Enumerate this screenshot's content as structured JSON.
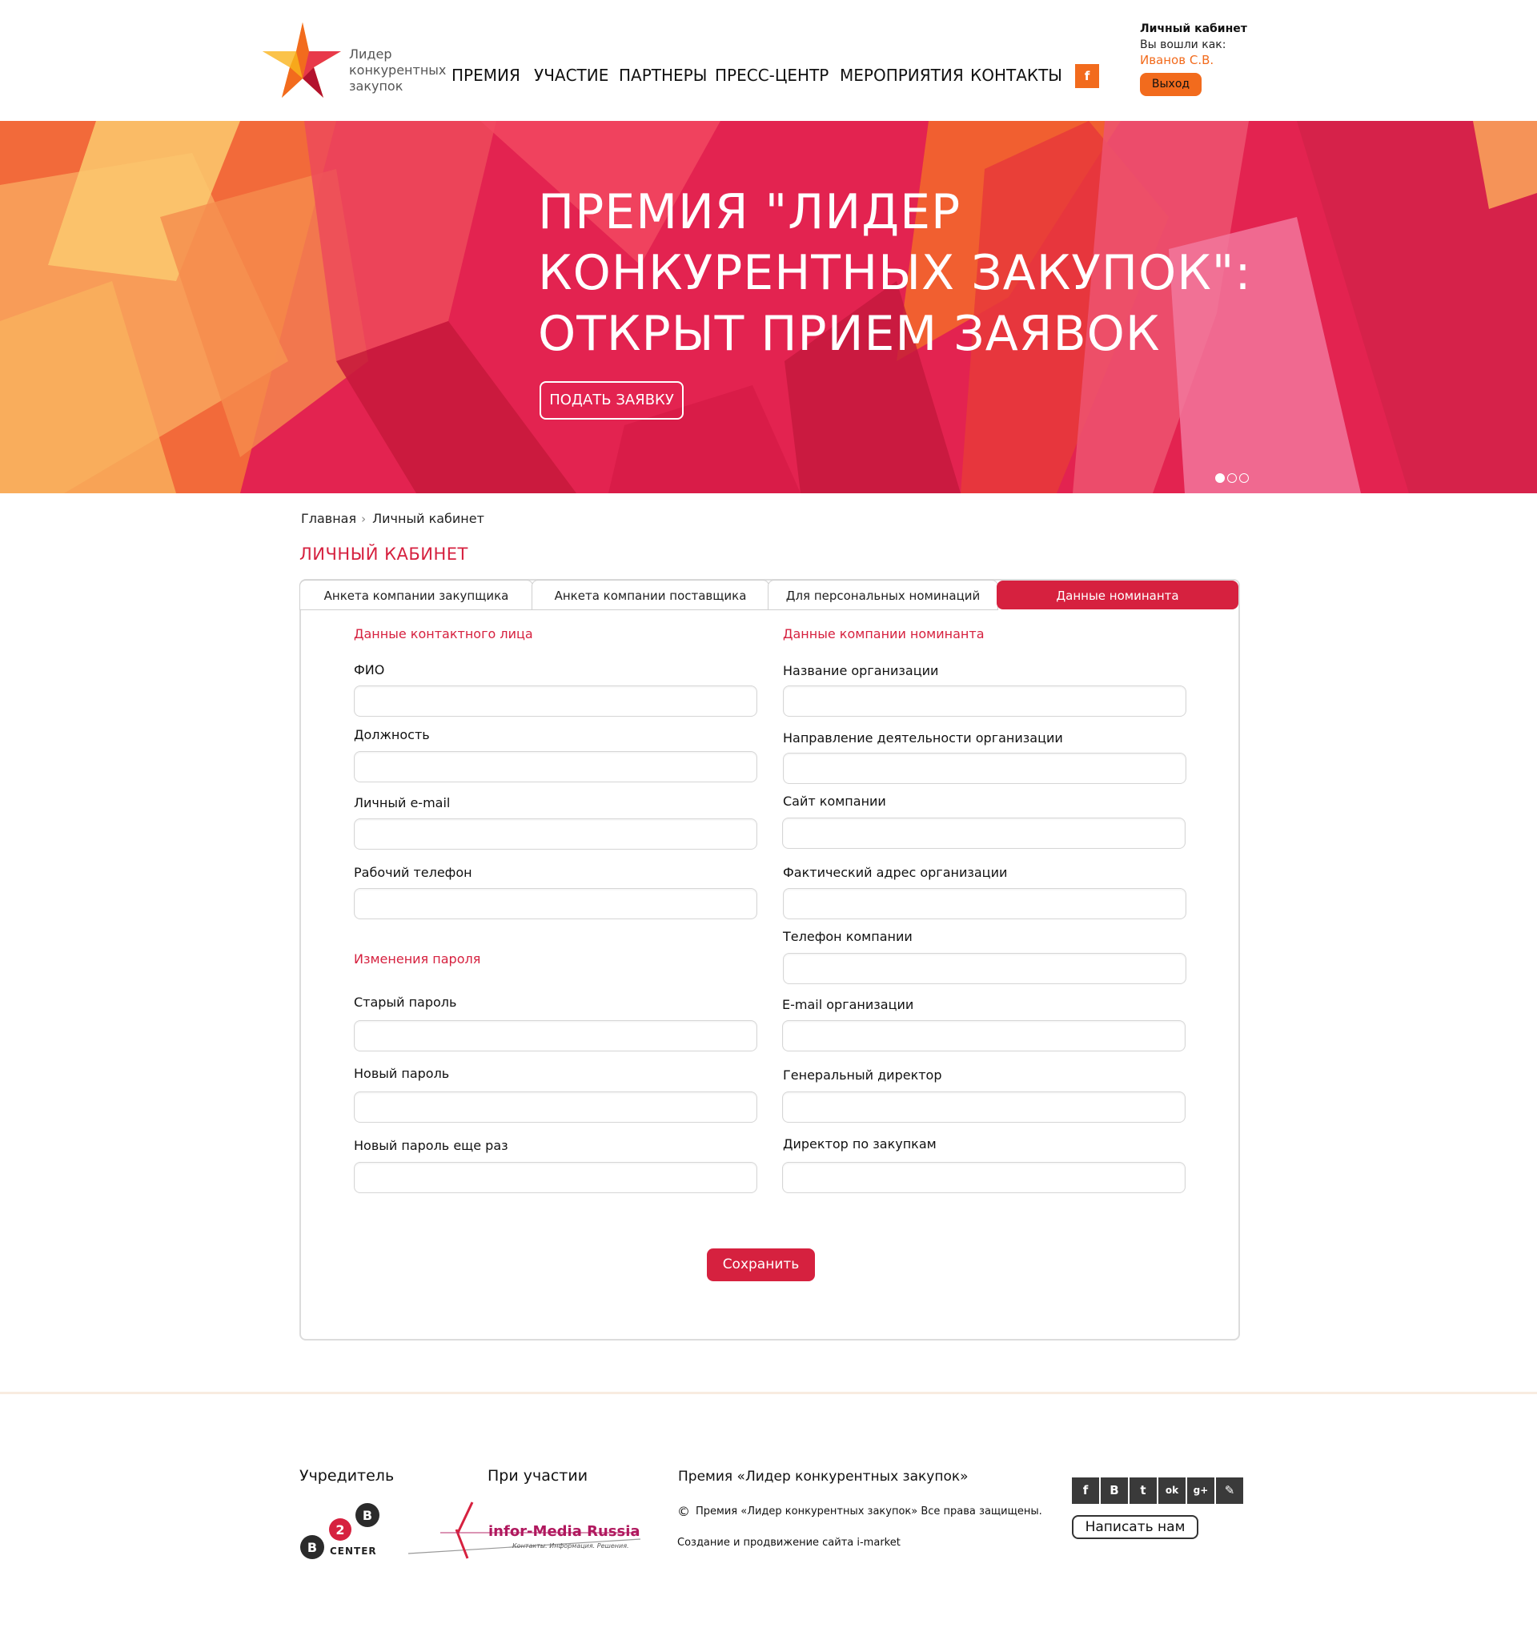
{
  "header": {
    "logo_lines": [
      "Лидер",
      "конкурентных",
      "закупок"
    ],
    "nav": [
      "ПРЕМИЯ",
      "УЧАСТИЕ",
      "ПАРТНЕРЫ",
      "ПРЕСС-ЦЕНТР",
      "МЕРОПРИЯТИЯ",
      "КОНТАКТЫ"
    ],
    "fb_label": "f",
    "account": {
      "title": "Личный кабинет",
      "logged_as": "Вы вошли как:",
      "user": "Иванов С.В.",
      "logout": "Выход"
    }
  },
  "banner": {
    "title_lines": [
      "ПРЕМИЯ \"ЛИДЕР",
      "КОНКУРЕНТНЫХ ЗАКУПОК\":",
      "ОТКРЫТ ПРИЕМ ЗАЯВОК"
    ],
    "button": "ПОДАТЬ ЗАЯВКУ",
    "slides": 3,
    "active_slide": 1
  },
  "breadcrumb": {
    "home": "Главная",
    "current": "Личный кабинет"
  },
  "page_title": "ЛИЧНЫЙ КАБИНЕТ",
  "tabs": [
    "Анкета компании закупщика",
    "Анкета компании поставщика",
    "Для персональных номинаций",
    "Данные номинанта"
  ],
  "active_tab": "Данные номинанта",
  "form": {
    "contact": {
      "title": "Данные контактного лица",
      "fields": [
        "ФИО",
        "Должность",
        "Личный e-mail",
        "Рабочий телефон"
      ]
    },
    "password": {
      "title": "Изменения пароля",
      "fields": [
        "Старый пароль",
        "Новый пароль",
        "Новый пароль еще раз"
      ]
    },
    "company": {
      "title": "Данные компании номинанта",
      "fields": [
        "Название организации",
        "Направление деятельности организации",
        "Сайт компании",
        "Фактический адрес организации",
        "Телефон компании",
        "E-mail организации",
        "Генеральный директор",
        "Директор по закупкам"
      ]
    },
    "save": "Сохранить"
  },
  "footer": {
    "founder": "Учредитель",
    "participation": "При участии",
    "award": "Премия «Лидер конкурентных закупок»",
    "rights": "Премия «Лидер конкурентных закупок» Все права защищены.",
    "dev": "Создание и продвижение сайта i-market",
    "b2b_center": "CENTER",
    "infor_media": "infor-Media Russia",
    "infor_tagline": "Контакты. Информация. Решения.",
    "social": [
      "f",
      "В",
      "t",
      "ok",
      "g+",
      "✎"
    ],
    "write": "Написать нам"
  }
}
